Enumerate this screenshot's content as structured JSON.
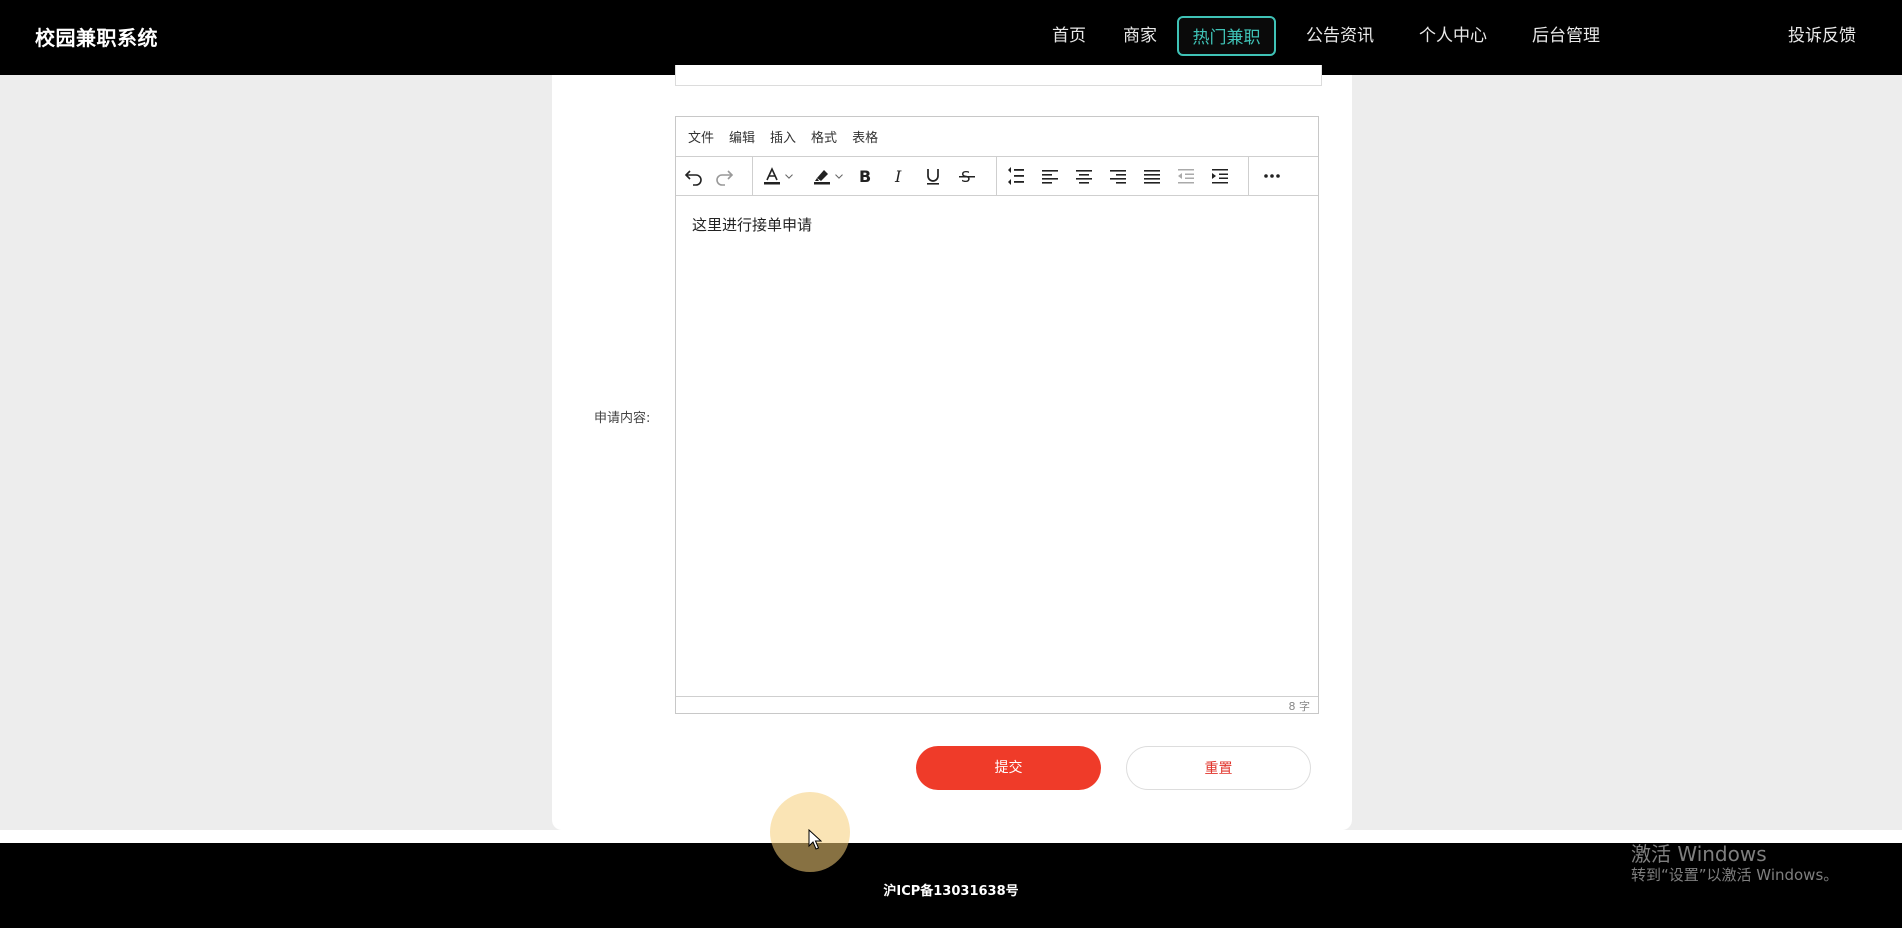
{
  "header": {
    "brand": "校园兼职系统",
    "nav": [
      {
        "label": "首页"
      },
      {
        "label": "商家"
      },
      {
        "label": "热门兼职"
      },
      {
        "label": "公告资讯"
      },
      {
        "label": "个人中心"
      },
      {
        "label": "后台管理"
      },
      {
        "label": "投诉反馈"
      }
    ],
    "active_index": 2,
    "active_color": "#3fc2b6"
  },
  "form": {
    "content_label": "申请内容:",
    "editor": {
      "menus": [
        "文件",
        "编辑",
        "插入",
        "格式",
        "表格"
      ],
      "toolbar_icons": [
        "undo-icon",
        "redo-icon",
        "text-color-icon",
        "text-color-dropdown-icon",
        "highlight-color-icon",
        "highlight-dropdown-icon",
        "bold-icon",
        "italic-icon",
        "underline-icon",
        "strikethrough-icon",
        "line-height-icon",
        "align-left-icon",
        "align-center-icon",
        "align-right-icon",
        "align-justify-icon",
        "outdent-icon",
        "indent-icon",
        "more-icon"
      ],
      "content": "这里进行接单申请",
      "word_count": "8 字"
    },
    "submit_label": "提交",
    "reset_label": "重置",
    "submit_color": "#ef3b29"
  },
  "footer": {
    "icp": "沪ICP备13031638号"
  },
  "watermark": {
    "line1": "激活 Windows",
    "line2": "转到“设置”以激活 Windows。"
  }
}
